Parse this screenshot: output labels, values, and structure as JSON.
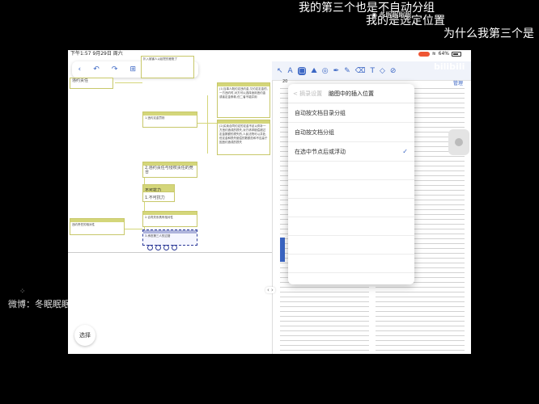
{
  "subtitles": [
    "我的第三个也是不自动分组",
    "我的是选定位置",
    "为什么我第三个是"
  ],
  "watermark": {
    "weibo_prefix": "微博：",
    "weibo_name": "冬眠眠眠",
    "weibo_ghost": "眠眠",
    "bili_name": "冬眠眠眠眠",
    "bili_logo": "bilibili"
  },
  "status_bar": {
    "time": "下午1:57",
    "date": "9月29日 周六",
    "battery": "64%"
  },
  "mindmap": {
    "nodes": [
      "扒入被害人以起挖的差账了",
      "违约责任",
      "1.违约定金罚则",
      "(1)当事人既约定违约金,又约定定金的,一方违约时,对方可以选择适用违约金或者定金条款,但二者不能并用",
      "(2)买卖合同约定的定金不足以弥补一方违约造成的损失,对方请求赔偿超过定金数额的损失的,人民法院可以并处,但定金和损失赔偿的数额总和不应高于因违约造成的损失",
      "2.违约责任与侵权责任的竞合",
      "不可抗力",
      "1.不可抗力",
      "2.合同关系具有相对性",
      "违约责任的相对性",
      "3.承担第三人的过错"
    ]
  },
  "select_button": "选择",
  "doc": {
    "header": "20",
    "manage": "管理"
  },
  "popover": {
    "back": "< 摘录设置",
    "title": "脑图中的插入位置",
    "options": [
      "自动按文档目录分组",
      "自动按文档分组",
      "在选中节点后或浮动"
    ],
    "selected_index": 2,
    "check": "✓"
  }
}
